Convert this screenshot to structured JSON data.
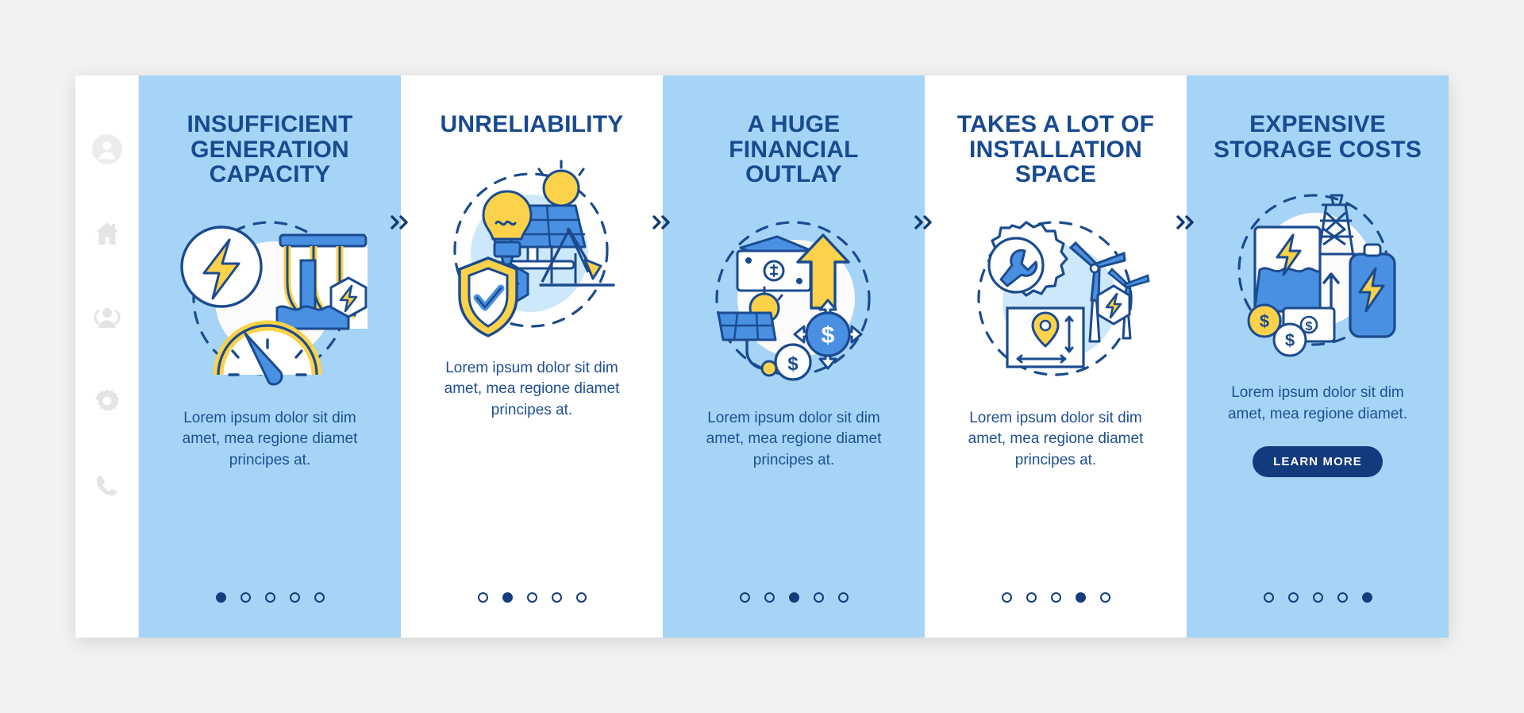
{
  "theme": {
    "page_bg": "#f2f2f2",
    "card_bg": "#ffffff",
    "panel_blue": "#a5d4f7",
    "panel_white": "#ffffff",
    "title_color": "#184a8f",
    "body_color": "#1f4f91",
    "dot_color": "#143d7e",
    "button_bg": "#123a7d",
    "button_text": "#ffffff",
    "accent_yellow": "#fbd24a",
    "accent_blue": "#4a90e2",
    "sidebar_icon_color": "#e4e4e4"
  },
  "sidebar": {
    "items": [
      {
        "icon": "user-avatar-icon",
        "label": "Profile"
      },
      {
        "icon": "home-icon",
        "label": "Home"
      },
      {
        "icon": "people-group-icon",
        "label": "Team"
      },
      {
        "icon": "gear-icon",
        "label": "Settings"
      },
      {
        "icon": "phone-icon",
        "label": "Contact"
      }
    ]
  },
  "separator": {
    "glyph": "»",
    "name": "double-chevron-right"
  },
  "panels": [
    {
      "id": "insufficient-generation-capacity",
      "style": "blue",
      "title": "INSUFFICIENT GENERATION CAPACITY",
      "body": "Lorem ipsum dolor sit dim amet, mea regione diamet principes at.",
      "illustration": "hydro-dam-lightning-gauge-illustration",
      "dots": {
        "count": 5,
        "active": 1
      },
      "button": null
    },
    {
      "id": "unreliability",
      "style": "white",
      "title": "UNRELIABILITY",
      "body": "Lorem ipsum dolor sit dim amet, mea regione diamet principes at.",
      "illustration": "solar-panel-bulb-shield-chart-illustration",
      "dots": {
        "count": 5,
        "active": 2
      },
      "button": null
    },
    {
      "id": "a-huge-financial-outlay",
      "style": "blue",
      "title": "A HUGE FINANCIAL OUTLAY",
      "body": "Lorem ipsum dolor sit dim amet, mea regione diamet principes at.",
      "illustration": "money-arrow-solar-dollar-illustration",
      "dots": {
        "count": 5,
        "active": 3
      },
      "button": null
    },
    {
      "id": "takes-a-lot-of-installation-space",
      "style": "white",
      "title": "TAKES A LOT OF INSTALLATION SPACE",
      "body": "Lorem ipsum dolor sit dim amet, mea regione diamet principes at.",
      "illustration": "gear-wrench-windmill-map-pin-illustration",
      "dots": {
        "count": 5,
        "active": 4
      },
      "button": null
    },
    {
      "id": "expensive-storage-costs",
      "style": "blue",
      "title": "EXPENSIVE STORAGE COSTS",
      "body": "Lorem ipsum dolor sit dim amet, mea regione diamet.",
      "illustration": "battery-pylon-coins-illustration",
      "dots": {
        "count": 5,
        "active": 5
      },
      "button": "LEARN MORE"
    }
  ]
}
